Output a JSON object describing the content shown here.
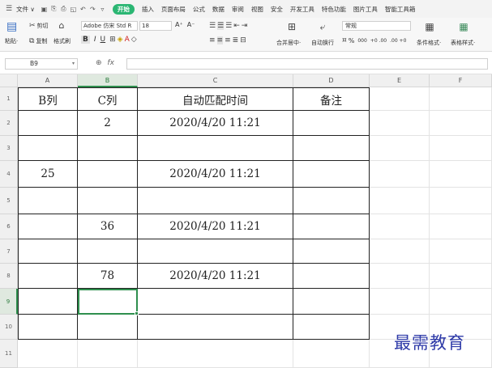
{
  "menubar": {
    "file": "文件 ∨",
    "tabs": [
      "开始",
      "插入",
      "页面布局",
      "公式",
      "数据",
      "审阅",
      "视图",
      "安全",
      "开发工具",
      "特色功能",
      "图片工具",
      "智能工具箱"
    ],
    "active_tab": "开始"
  },
  "ribbon": {
    "paste": "粘贴·",
    "cut": "剪切",
    "copy": "复制",
    "format_painter": "格式刷",
    "font_name": "Adobe 仿宋 Std R",
    "font_size": "18",
    "grow_font": "A⁺",
    "shrink_font": "A⁻",
    "bold": "B",
    "italic": "I",
    "underline": "U",
    "merge_center": "合并居中·",
    "wrap_text": "自动换行",
    "number_format": "常规",
    "percent": "%",
    "thousands": "000",
    "inc_decimal": "+0 .00",
    "dec_decimal": ".00 +0",
    "cond_format": "条件格式·",
    "table_style": "表格样式·"
  },
  "formula_bar": {
    "name_box": "B9",
    "fx": "fx",
    "formula": ""
  },
  "grid": {
    "columns": [
      "A",
      "B",
      "C",
      "D",
      "E",
      "F"
    ],
    "rows": [
      "1",
      "2",
      "3",
      "4",
      "5",
      "6",
      "7",
      "8",
      "9",
      "10",
      "11"
    ],
    "selected_cell": "B9",
    "headers": [
      "B列",
      "C列",
      "自动匹配时间",
      "备注"
    ],
    "data": [
      [
        "",
        "2",
        "2020/4/20 11:21",
        ""
      ],
      [
        "",
        "",
        "",
        ""
      ],
      [
        "25",
        "",
        "2020/4/20 11:21",
        ""
      ],
      [
        "",
        "",
        "",
        ""
      ],
      [
        "",
        "36",
        "2020/4/20 11:21",
        ""
      ],
      [
        "",
        "",
        "",
        ""
      ],
      [
        "",
        "78",
        "2020/4/20 11:21",
        ""
      ],
      [
        "",
        "",
        "",
        ""
      ],
      [
        "",
        "",
        "",
        ""
      ]
    ]
  },
  "watermark": "最需教育"
}
